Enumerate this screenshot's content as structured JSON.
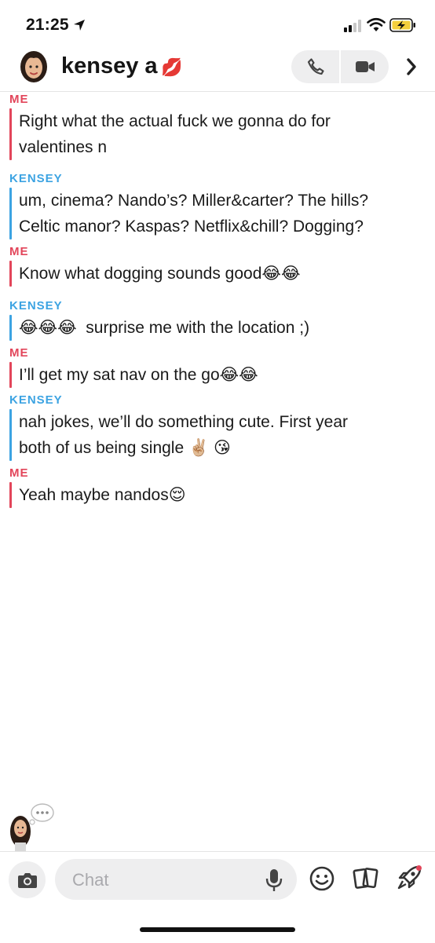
{
  "status_bar": {
    "time": "21:25"
  },
  "header": {
    "contact_name": "kensey a",
    "contact_emoji": "💋"
  },
  "messages": [
    {
      "sender": "ME",
      "text": "Right what the actual fuck we gonna do for\nvalentines n"
    },
    {
      "sender": "KENSEY",
      "text": "um, cinema? Nando’s? Miller&carter? The hills?\nCeltic manor? Kaspas? Netflix&chill? Dogging?"
    },
    {
      "sender": "ME",
      "text": "Know what dogging sounds good😂😂"
    },
    {
      "sender": "KENSEY",
      "text": "😂😂😂  surprise me with the location ;)"
    },
    {
      "sender": "ME",
      "text": "I’ll get my sat nav on the go😂😂"
    },
    {
      "sender": "KENSEY",
      "text": "nah jokes, we’ll do something cute. First year\nboth of us being single ✌🏼 😘"
    },
    {
      "sender": "ME",
      "text": "Yeah maybe nandos😌"
    }
  ],
  "composer": {
    "placeholder": "Chat"
  },
  "colors": {
    "me": "#e2455a",
    "them": "#3ca3e2",
    "pill": "#eeeeef"
  },
  "icons": [
    "location-arrow-icon",
    "signal-icon",
    "wifi-icon",
    "battery-charging-icon",
    "phone-icon",
    "video-camera-icon",
    "chevron-right-icon",
    "camera-icon",
    "microphone-icon",
    "smiley-icon",
    "cards-icon",
    "rocket-icon"
  ]
}
